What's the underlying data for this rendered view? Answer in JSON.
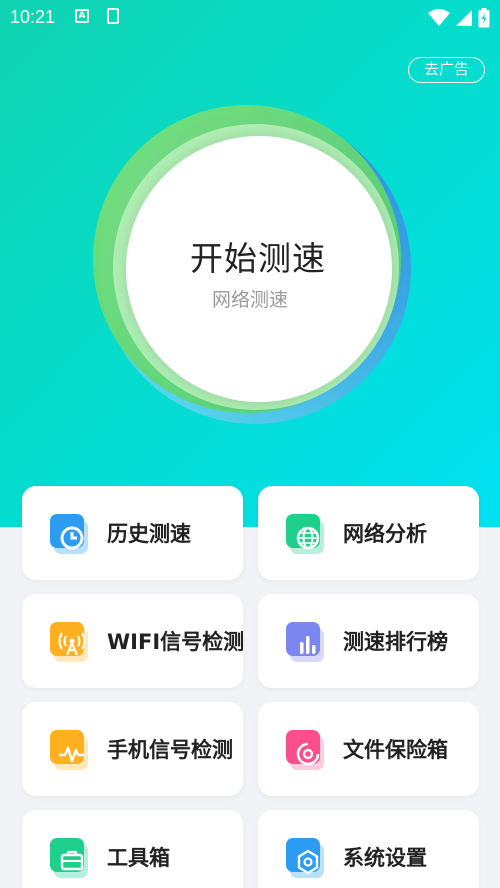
{
  "status_bar": {
    "time": "10:21",
    "a_icon": "A"
  },
  "header": {
    "ad_button": "去广告"
  },
  "dial": {
    "title": "开始测速",
    "subtitle": "网络测速"
  },
  "menu": [
    {
      "label": "历史测速",
      "icon": "clock-icon"
    },
    {
      "label": "网络分析",
      "icon": "globe-icon"
    },
    {
      "label": "WIFI信号检测",
      "icon": "signal-tower-icon"
    },
    {
      "label": "测速排行榜",
      "icon": "bar-chart-icon"
    },
    {
      "label": "手机信号检测",
      "icon": "pulse-icon"
    },
    {
      "label": "文件保险箱",
      "icon": "safe-icon"
    },
    {
      "label": "工具箱",
      "icon": "toolbox-icon"
    },
    {
      "label": "系统设置",
      "icon": "hexagon-settings-icon"
    }
  ]
}
